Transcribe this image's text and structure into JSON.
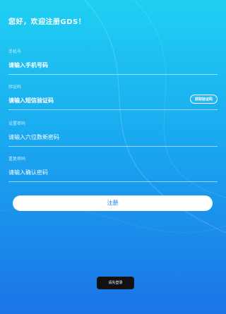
{
  "greeting": "您好，欢迎注册GDS！",
  "form": {
    "phone": {
      "label": "手机号",
      "placeholder": "请输入手机号码"
    },
    "code": {
      "label": "验证码",
      "placeholder": "请输入短信验证码",
      "button": "获取验证码"
    },
    "password": {
      "label": "设置密码",
      "placeholder": "请输入六位数新密码"
    },
    "confirm": {
      "label": "重复密码",
      "placeholder": "请输入确认密码"
    }
  },
  "register_button": "注册",
  "back_button": "请先登录",
  "colors": {
    "top": "#1fd0f2",
    "bottom": "#1b74e6",
    "button_text": "#1b7fe9"
  }
}
